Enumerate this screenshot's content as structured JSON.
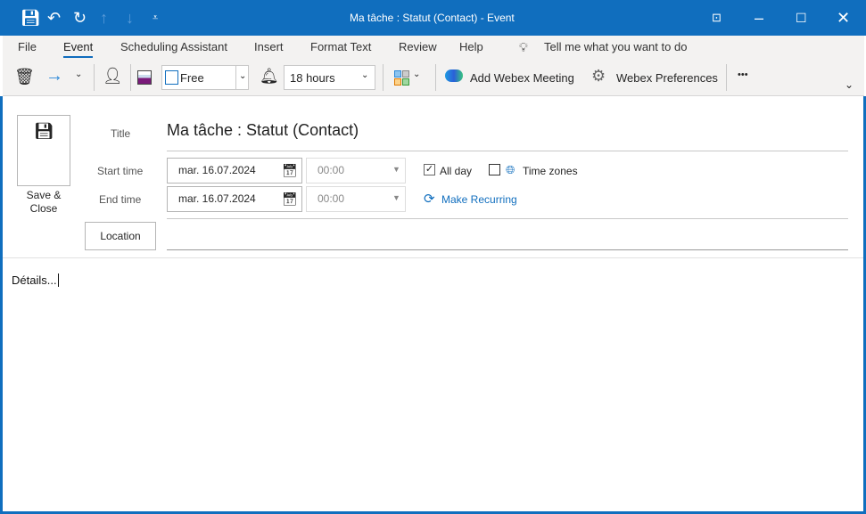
{
  "window": {
    "title": "Ma tâche : Statut (Contact)  -  Event"
  },
  "quick_access": [
    "save-icon",
    "undo-icon",
    "redo-icon",
    "up-icon",
    "down-icon",
    "customize-icon"
  ],
  "menu": [
    "File",
    "Event",
    "Scheduling Assistant",
    "Insert",
    "Format Text",
    "Review",
    "Help"
  ],
  "active_menu": "Event",
  "tell_me": "Tell me what you want to do",
  "ribbon": {
    "show_as": "Free",
    "reminder": "18 hours",
    "add_webex": "Add Webex Meeting",
    "webex_prefs": "Webex Preferences",
    "more": "•••"
  },
  "form": {
    "save_close": "Save &\nClose",
    "title_label": "Title",
    "title_value": "Ma tâche : Statut (Contact)",
    "start_label": "Start time",
    "start_date": "mar. 16.07.2024",
    "start_time": "00:00",
    "end_label": "End time",
    "end_date": "mar. 16.07.2024",
    "end_time": "00:00",
    "all_day": "All day",
    "all_day_checked": true,
    "time_zones": "Time zones",
    "time_zones_checked": false,
    "make_recurring": "Make Recurring",
    "location": "Location",
    "details": "Détails..."
  },
  "colors": {
    "titlebar": "#106ebe",
    "accent": "#0f6cbd",
    "link": "#106ebe"
  }
}
